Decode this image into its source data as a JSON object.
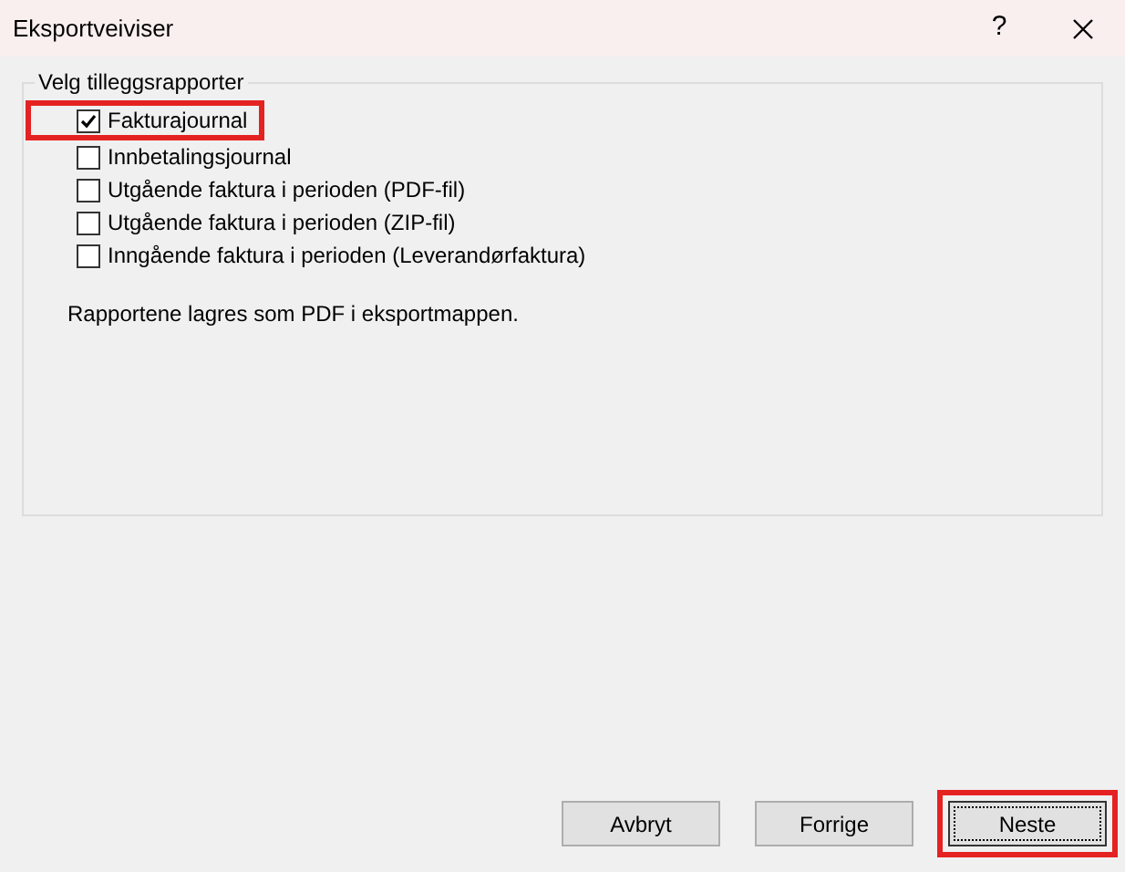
{
  "window": {
    "title": "Eksportveiviser",
    "help": "?"
  },
  "group": {
    "title": "Velg tilleggsrapporter",
    "options": [
      {
        "label": "Fakturajournal",
        "checked": true,
        "highlighted": true
      },
      {
        "label": "Innbetalingsjournal",
        "checked": false,
        "highlighted": false
      },
      {
        "label": "Utgående faktura i perioden (PDF-fil)",
        "checked": false,
        "highlighted": false
      },
      {
        "label": "Utgående faktura i perioden (ZIP-fil)",
        "checked": false,
        "highlighted": false
      },
      {
        "label": "Inngående faktura i perioden (Leverandørfaktura)",
        "checked": false,
        "highlighted": false
      }
    ],
    "note": "Rapportene lagres som PDF i eksportmappen."
  },
  "buttons": [
    {
      "label": "Avbryt",
      "focused": false,
      "highlighted": false
    },
    {
      "label": "Forrige",
      "focused": false,
      "highlighted": false
    },
    {
      "label": "Neste",
      "focused": true,
      "highlighted": true
    }
  ]
}
